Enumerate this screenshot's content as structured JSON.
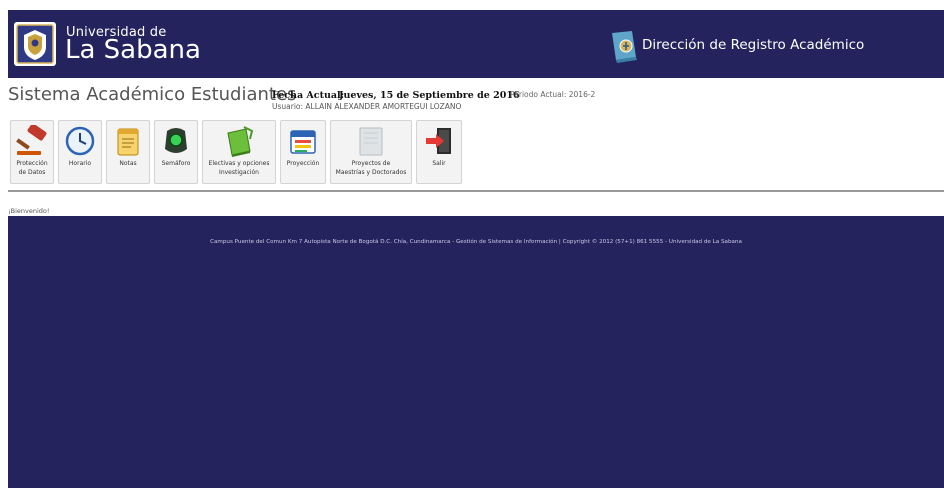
{
  "header": {
    "university_small": "Universidad de",
    "university_big": "La Sabana",
    "directorate": "Dirección de Registro Académico"
  },
  "info": {
    "system_title": "Sistema Académico Estudiantes",
    "fecha_label": "Fecha Actual:",
    "fecha_value": "Jueves, 15 de Septiembre de 2016",
    "usuario": "Usuario: ALLAIN ALEXANDER AMORTEGUI LOZANO",
    "periodo": "Periodo Actual: 2016-2"
  },
  "toolbar": {
    "items": [
      {
        "line1": "Protección",
        "line2": "de Datos",
        "icon": "gavel-icon"
      },
      {
        "line1": "Horario",
        "line2": "",
        "icon": "clock-icon"
      },
      {
        "line1": "Notas",
        "line2": "",
        "icon": "notepad-icon"
      },
      {
        "line1": "Semáforo",
        "line2": "",
        "icon": "traffic-light-icon"
      },
      {
        "line1": "Electivas y opciones",
        "line2": "Investigación",
        "icon": "book-icon"
      },
      {
        "line1": "Proyección",
        "line2": "",
        "icon": "calendar-icon"
      },
      {
        "line1": "Proyectos de",
        "line2": "Maestrías y Doctorados",
        "icon": "document-icon"
      },
      {
        "line1": "Salir",
        "line2": "",
        "icon": "exit-icon"
      }
    ]
  },
  "welcome": "¡Bienvenido!",
  "footer": {
    "text": "Campus Puente del Comun Km 7 Autopista Norte de Bogotá D.C. Chía, Cundinamarca - Gestión de Sistemas de Información | Copyright © 2012 (57+1) 861 5555 - Universidad de La Sabana"
  },
  "colors": {
    "brand_navy": "#24235e",
    "footer_text": "#c9c9e6"
  }
}
